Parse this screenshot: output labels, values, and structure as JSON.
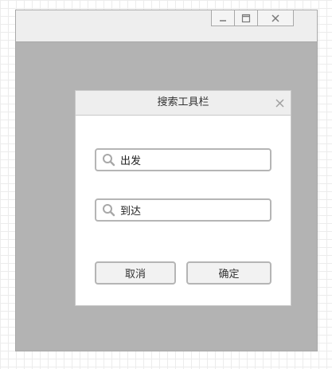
{
  "window": {
    "controls": [
      {
        "name": "minimize",
        "icon": "minimize-icon"
      },
      {
        "name": "maximize",
        "icon": "maximize-icon"
      },
      {
        "name": "close",
        "icon": "close-icon"
      }
    ]
  },
  "dialog": {
    "title": "搜索工具栏",
    "close_icon": "close-icon",
    "fields": {
      "depart": {
        "value": "出发",
        "icon": "search-icon"
      },
      "arrive": {
        "value": "到达",
        "icon": "search-icon"
      }
    },
    "buttons": {
      "cancel": "取消",
      "ok": "确定"
    }
  },
  "colors": {
    "window_background": "#b3b3b3",
    "titlebar": "#eeeeee",
    "border": "#a8a8a8",
    "field_border": "#b5b5b5"
  }
}
